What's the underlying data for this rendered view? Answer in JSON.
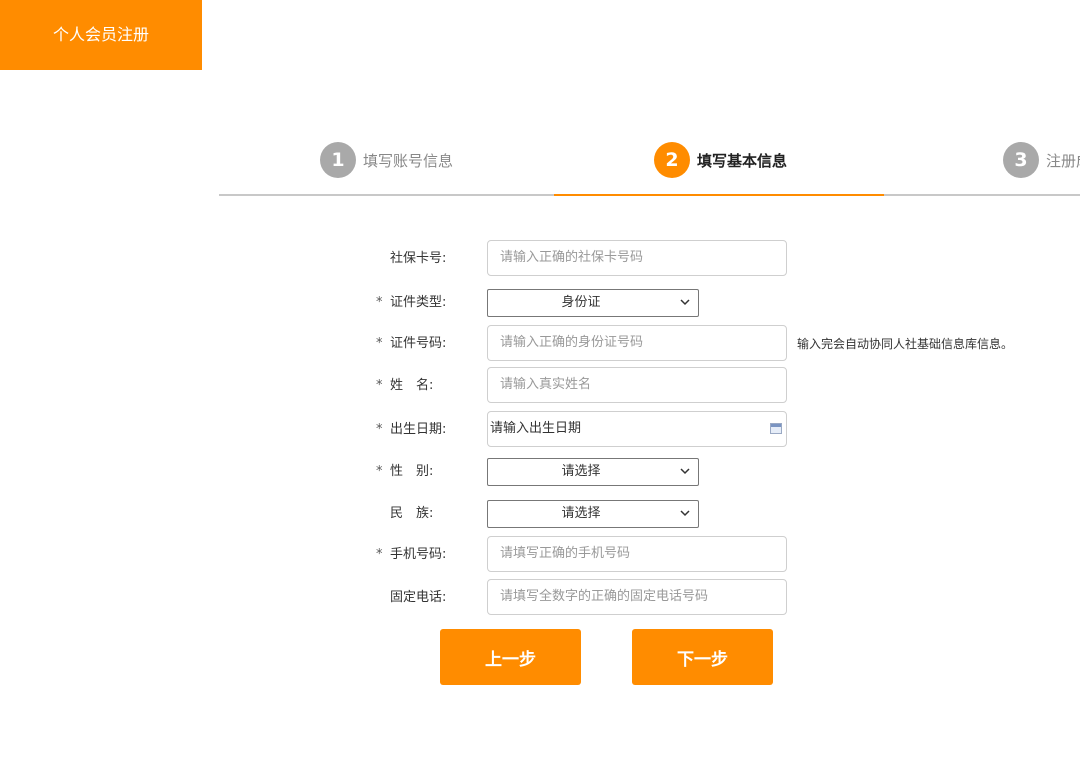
{
  "header": {
    "tab_label": "个人会员注册"
  },
  "steps": [
    {
      "num": "1",
      "label": "填写账号信息",
      "active": false
    },
    {
      "num": "2",
      "label": "填写基本信息",
      "active": true
    },
    {
      "num": "3",
      "label": "注册成功",
      "active": false
    }
  ],
  "form": {
    "social_card": {
      "label": "社保卡号:",
      "placeholder": "请输入正确的社保卡号码",
      "required": false
    },
    "id_type": {
      "label": "证件类型:",
      "value": "身份证",
      "required": true
    },
    "id_number": {
      "label": "证件号码:",
      "placeholder": "请输入正确的身份证号码",
      "required": true,
      "hint": "输入完会自动协同人社基础信息库信息。"
    },
    "name": {
      "label": "姓　名:",
      "placeholder": "请输入真实姓名",
      "required": true
    },
    "birthdate": {
      "label": "出生日期:",
      "placeholder": "请输入出生日期",
      "required": true
    },
    "gender": {
      "label": "性　别:",
      "value": "请选择",
      "required": true
    },
    "ethnicity": {
      "label": "民　族:",
      "value": "请选择",
      "required": false
    },
    "mobile": {
      "label": "手机号码:",
      "placeholder": "请填写正确的手机号码",
      "required": true
    },
    "landline": {
      "label": "固定电话:",
      "placeholder": "请填写全数字的正确的固定电话号码",
      "required": false
    },
    "required_mark": "*"
  },
  "buttons": {
    "prev": "上一步",
    "next": "下一步"
  },
  "colors": {
    "accent": "#ff8c00",
    "inactive_step": "#a9a9a9",
    "divider": "#c8c8c8"
  }
}
